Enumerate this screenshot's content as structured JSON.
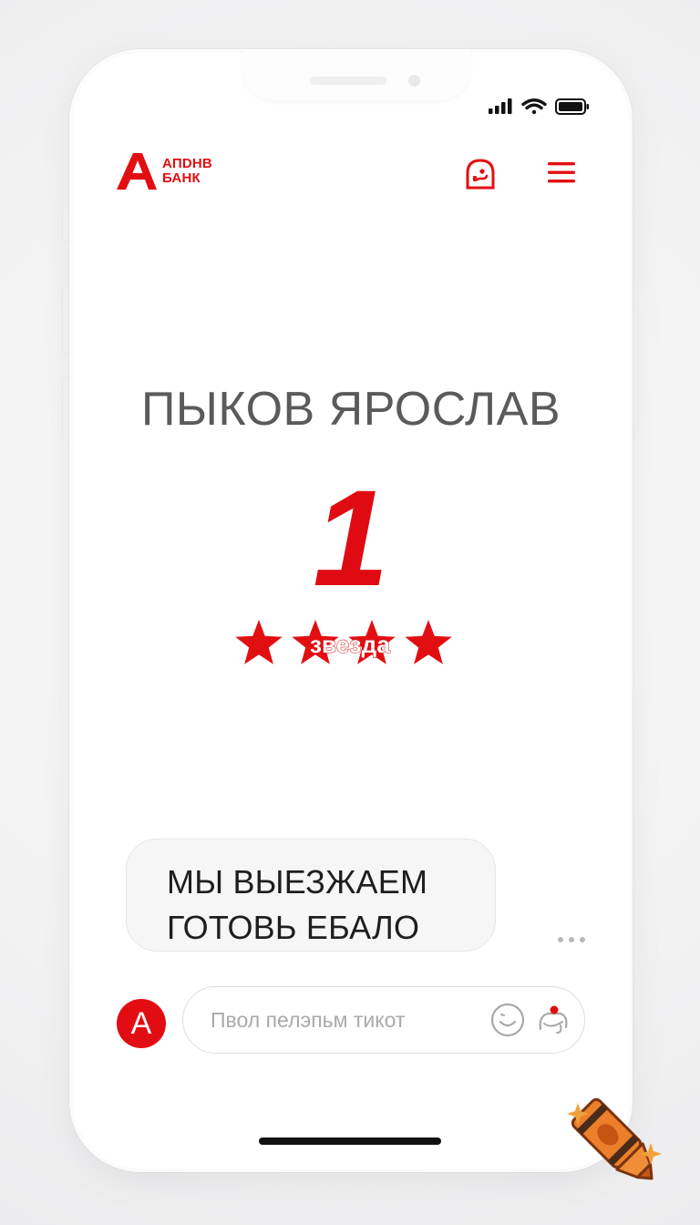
{
  "status_bar": {
    "signal_icon": "signal-bars-icon",
    "wifi_icon": "wifi-icon",
    "battery_icon": "battery-icon"
  },
  "header": {
    "logo_line1": "АПDНВ",
    "logo_line2": "БАНК",
    "support_icon": "support-chat-icon",
    "menu_icon": "hamburger-menu-icon"
  },
  "profile": {
    "name": "ПЫКОВ ЯРОСЛАВ",
    "rating_value": "1",
    "rating_label": "звезда",
    "stars_shown": 4
  },
  "chat": {
    "message_text_line1": "МЫ ВЫЕЗЖАЕМ",
    "message_text_line2": "ГОТОВЬ ЕБАЛО",
    "avatar_letter": "A",
    "input_placeholder": "Пвол пелэпьм тикот"
  },
  "colors": {
    "brand_red": "#e20f12",
    "text_gray": "#5a5a5a",
    "bubble_bg": "#f6f6f6"
  }
}
